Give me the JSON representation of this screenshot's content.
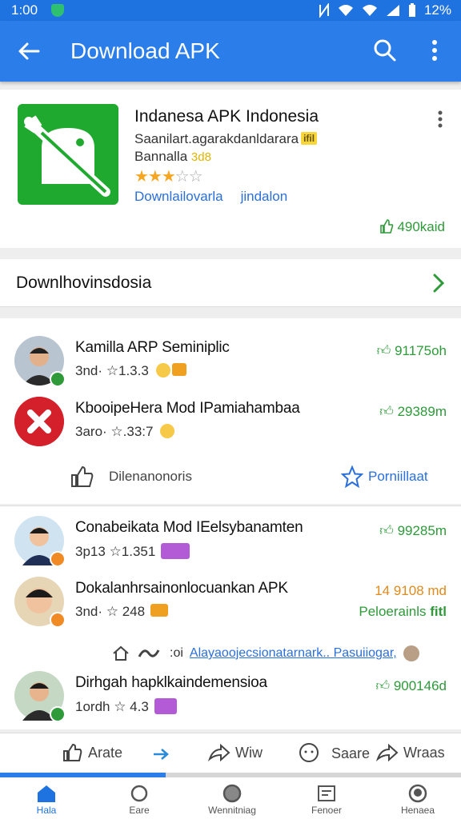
{
  "status_bar": {
    "time": "1:00",
    "battery": "12%"
  },
  "appbar": {
    "title": "Download APK"
  },
  "app": {
    "name": "Indanesa APK Indonesia",
    "subtitle": "Saanilart.agarakdanldarara",
    "subtitle_tag": "ifil",
    "subtitle2": "Bannalla",
    "subtitle2_tag": "3d8",
    "rating": 3,
    "rating_max": 5,
    "link1": "Downlailovarla",
    "link2": "jindalon",
    "count": "490kaid"
  },
  "section": {
    "label": "Downlhovinsdosia"
  },
  "items": [
    {
      "title": "Kamilla ARP Seminiplic",
      "meta_prefix": "3nd·",
      "rating": "☆1.3.3",
      "count": "91175oh"
    },
    {
      "title": "KbooipeHera Mod IPamiahambaa",
      "meta_prefix": "3aro·",
      "rating": "☆.33:7",
      "count": "29389m"
    },
    {
      "title": "Conabeikata Mod IEelsybanamten",
      "meta_prefix": "3p13",
      "rating": "☆1.351",
      "count": "99285m"
    },
    {
      "title": "Dokalanhrsainonlocuankan APK",
      "meta_prefix": "3nd·",
      "rating": "☆ 248",
      "count": "14 9108 md",
      "sub_count": "Peloerainls",
      "sub_tag": "fitl"
    },
    {
      "title": "Dirhgah hapklkaindemensioa",
      "meta_prefix": "1ordh",
      "rating": "☆ 4.3",
      "count": "900146d"
    }
  ],
  "card_actions": {
    "like": "Dilenanonoris",
    "favorite": "Porniillaat"
  },
  "info_line": {
    "prefix": ":oi",
    "link": "Alayaoojecsionatarnark.. Pasuiiogar,"
  },
  "bottom_actions": {
    "rate": "Arate",
    "view": "Wiw",
    "share": "Saare",
    "wraas": "Wraas"
  },
  "progress_fraction": 0.36,
  "nav": [
    {
      "label": "Hala",
      "icon": "home-icon",
      "active": true
    },
    {
      "label": "Eare",
      "icon": "circle-icon",
      "active": false
    },
    {
      "label": "Wennitniag",
      "icon": "heart-icon",
      "active": false
    },
    {
      "label": "Fenoer",
      "icon": "notes-icon",
      "active": false
    },
    {
      "label": "Henaea",
      "icon": "profile-icon",
      "active": false
    }
  ],
  "colors": {
    "primary": "#2b7de9",
    "green": "#2e9a3a",
    "link": "#2a6fdb",
    "star": "#f5a623"
  }
}
